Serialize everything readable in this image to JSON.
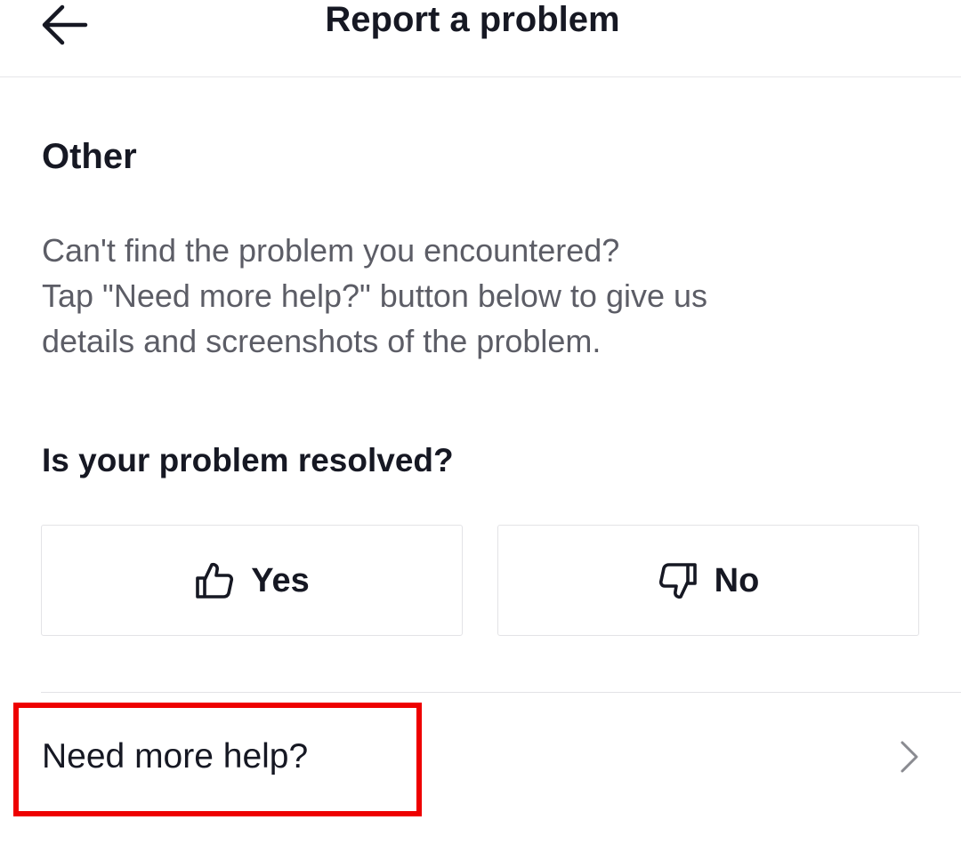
{
  "header": {
    "title": "Report a problem",
    "back_icon": "arrow-left-icon"
  },
  "section": {
    "title": "Other",
    "description": "Can't find the problem you encountered?\nTap \"Need more help?\" button below to give us\ndetails and screenshots of the problem."
  },
  "feedback": {
    "question": "Is your problem resolved?",
    "yes_label": "Yes",
    "yes_icon": "thumbs-up-icon",
    "no_label": "No",
    "no_icon": "thumbs-down-icon"
  },
  "help": {
    "label": "Need more help?",
    "chevron_icon": "chevron-right-icon"
  },
  "colors": {
    "text_primary": "#161823",
    "text_secondary": "#5c5d66",
    "border": "#e3e3e6",
    "highlight": "#ee0000"
  }
}
